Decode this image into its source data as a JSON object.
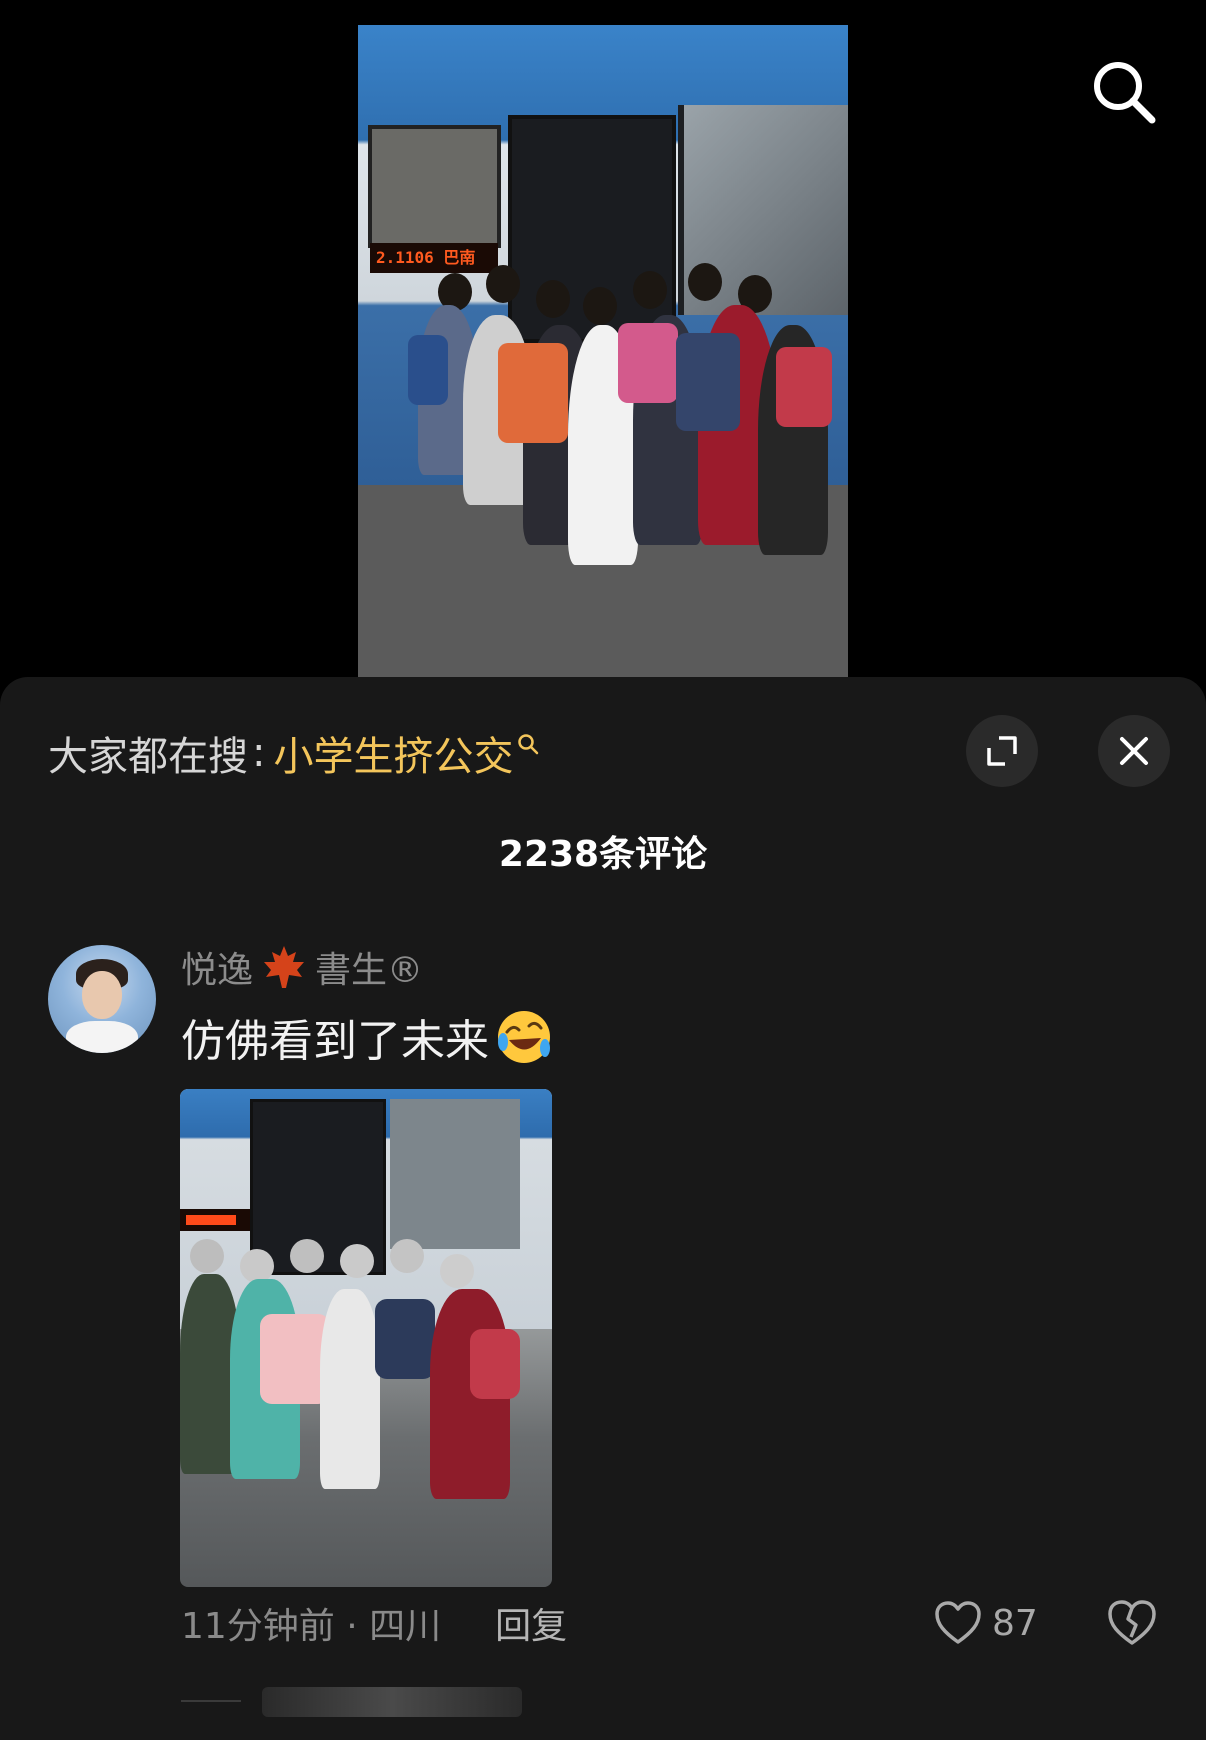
{
  "video": {
    "bus_led_text": "2.1106 巴南"
  },
  "top_bar": {
    "search_icon": "search-icon"
  },
  "sheet": {
    "hot_search": {
      "prefix": "大家都在搜",
      "colon": ":",
      "term": "小学生挤公交",
      "term_color": "#f3c55b"
    },
    "expand_icon": "expand-icon",
    "close_icon": "close-icon",
    "comment_count": "2238条评论",
    "comment": {
      "username_part1": "悦逸",
      "username_part2": "書生®",
      "text": "仿佛看到了未来",
      "emoji": "rolling-laughing-emoji",
      "time_location": "11分钟前 · 四川",
      "reply_label": "回复",
      "like_count": "87"
    }
  },
  "colors": {
    "background": "#000000",
    "sheet_background": "#181818",
    "accent": "#f3c55b"
  }
}
